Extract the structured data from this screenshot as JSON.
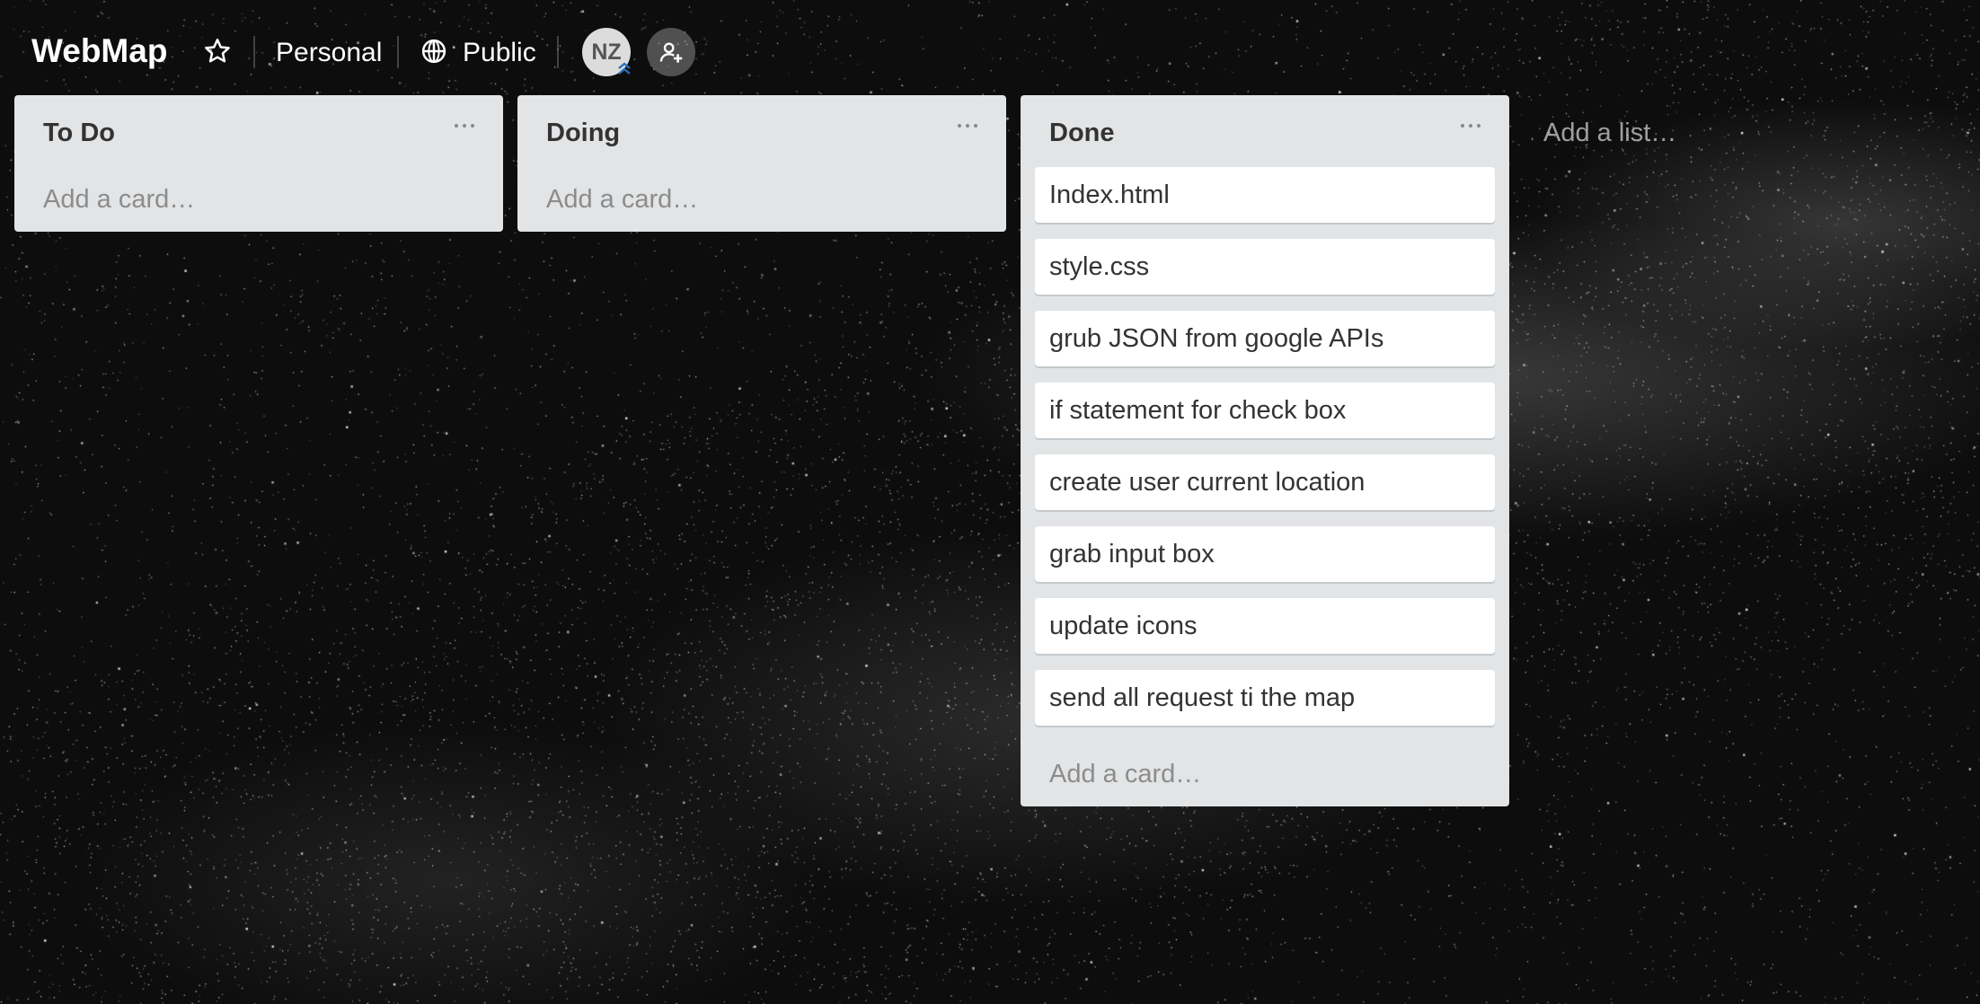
{
  "board": {
    "title": "WebMap",
    "team": "Personal",
    "visibility": "Public",
    "member_initials": "NZ"
  },
  "icons": {
    "star": "star-icon",
    "globe": "globe-icon",
    "add_member": "add-member-icon",
    "admin": "admin-chevron-icon",
    "menu": "more-horizontal-icon"
  },
  "lists": [
    {
      "title": "To Do",
      "cards": [],
      "add_card_label": "Add a card…"
    },
    {
      "title": "Doing",
      "cards": [],
      "add_card_label": "Add a card…"
    },
    {
      "title": "Done",
      "cards": [
        "Index.html",
        "style.css",
        "grub JSON from google APIs",
        "if statement for check box",
        "create user current location",
        "grab input box",
        "update icons",
        "send all request ti the map"
      ],
      "add_card_label": "Add a card…"
    }
  ],
  "add_list_label": "Add a list…",
  "colors": {
    "list_bg": "#e2e4e6",
    "card_bg": "#ffffff",
    "text": "#333333",
    "muted": "#8c8c8c"
  }
}
